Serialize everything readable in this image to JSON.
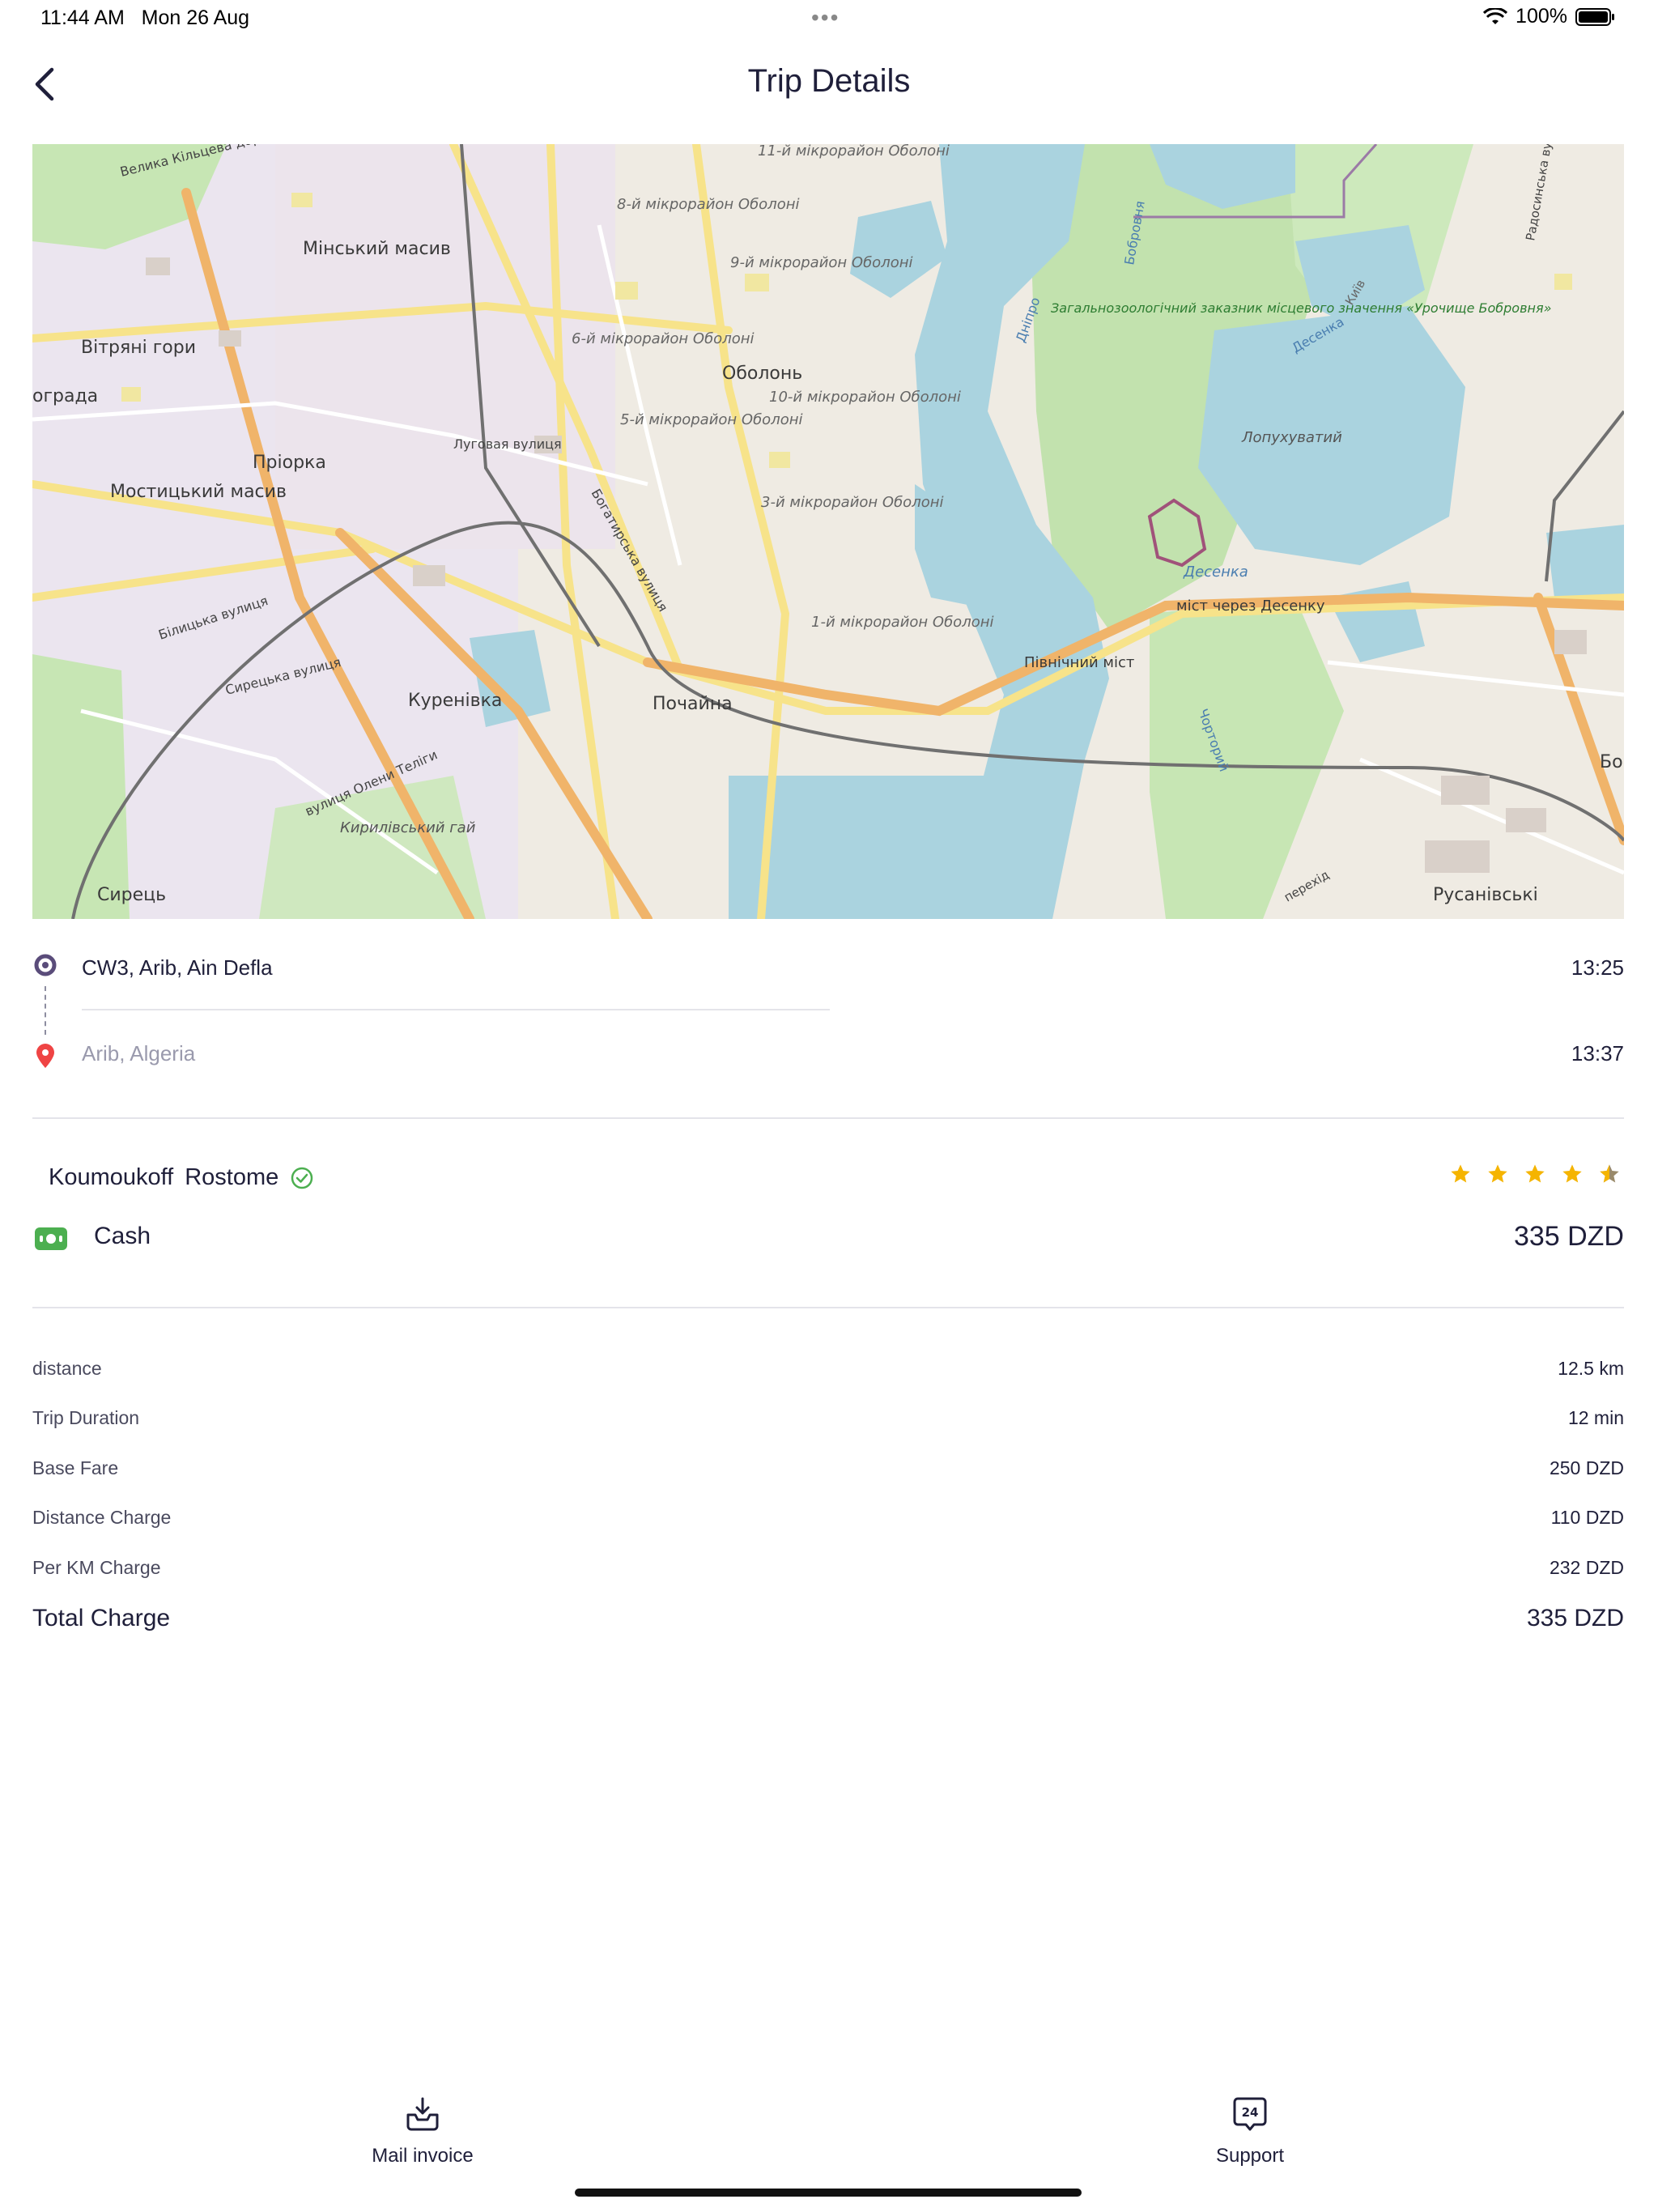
{
  "status_bar": {
    "time": "11:44 AM",
    "date": "Mon 26 Aug",
    "battery": "100%"
  },
  "header": {
    "title": "Trip Details"
  },
  "map": {
    "labels": [
      "Мінський масив",
      "Вітряні гори",
      "Пріорка",
      "Мостицький масив",
      "Куренівка",
      "Почайна",
      "Оболонь",
      "Сирець",
      "Русанівські",
      "Північний міст",
      "міст через Десенку",
      "Лопухуватий",
      "8-й мікрорайон Оболоні",
      "9-й мікрорайон Оболоні",
      "6-й мікрорайон Оболоні",
      "5-й мікрорайон Оболоні",
      "3-й мікрорайон Оболоні",
      "1-й мікрорайон Оболоні",
      "10-й мікрорайон Оболоні",
      "11-й мікрорайон Оболоні",
      "Кирилівський гай",
      "Десенка",
      "Луговая вулиця",
      "Богатирська вулиця",
      "Білицька вулиця",
      "Сирецька вулиця",
      "вулиця Олени Теліги",
      "Велика Кільцева дорога",
      "Загальнозоологічний заказник місцевого значення «Урочище Бобровня»",
      "Дніпро",
      "Чорторий",
      "Радосинська вулиця",
      "Десенка",
      "Бобровня",
      "Київ",
      "Бо",
      "перехід",
      "ограда"
    ]
  },
  "route": {
    "pickup": {
      "address": "CW3, Arib, Ain Defla",
      "time": "13:25"
    },
    "dropoff": {
      "address": "Arib, Algeria",
      "time": "13:37"
    }
  },
  "driver": {
    "first_name": "Koumoukoff",
    "last_name": "Rostome",
    "verified": true,
    "rating": 4.5
  },
  "payment": {
    "method": "Cash",
    "amount": "335 DZD"
  },
  "fare": {
    "rows": [
      {
        "label": "distance",
        "value": "12.5 km"
      },
      {
        "label": "Trip Duration",
        "value": "12 min"
      },
      {
        "label": "Base Fare",
        "value": "250 DZD"
      },
      {
        "label": "Distance Charge",
        "value": "110 DZD"
      },
      {
        "label": "Per KM Charge",
        "value": "232 DZD"
      }
    ],
    "total_label": "Total Charge",
    "total_value": "335 DZD"
  },
  "actions": {
    "mail_invoice": "Mail invoice",
    "support": "Support",
    "support_icon_text": "24"
  },
  "colors": {
    "accent": "#4caf50",
    "star": "#f5b400",
    "pickup_marker": "#5a4c7a",
    "dropoff_marker": "#ef4444",
    "water": "#aad3df"
  }
}
